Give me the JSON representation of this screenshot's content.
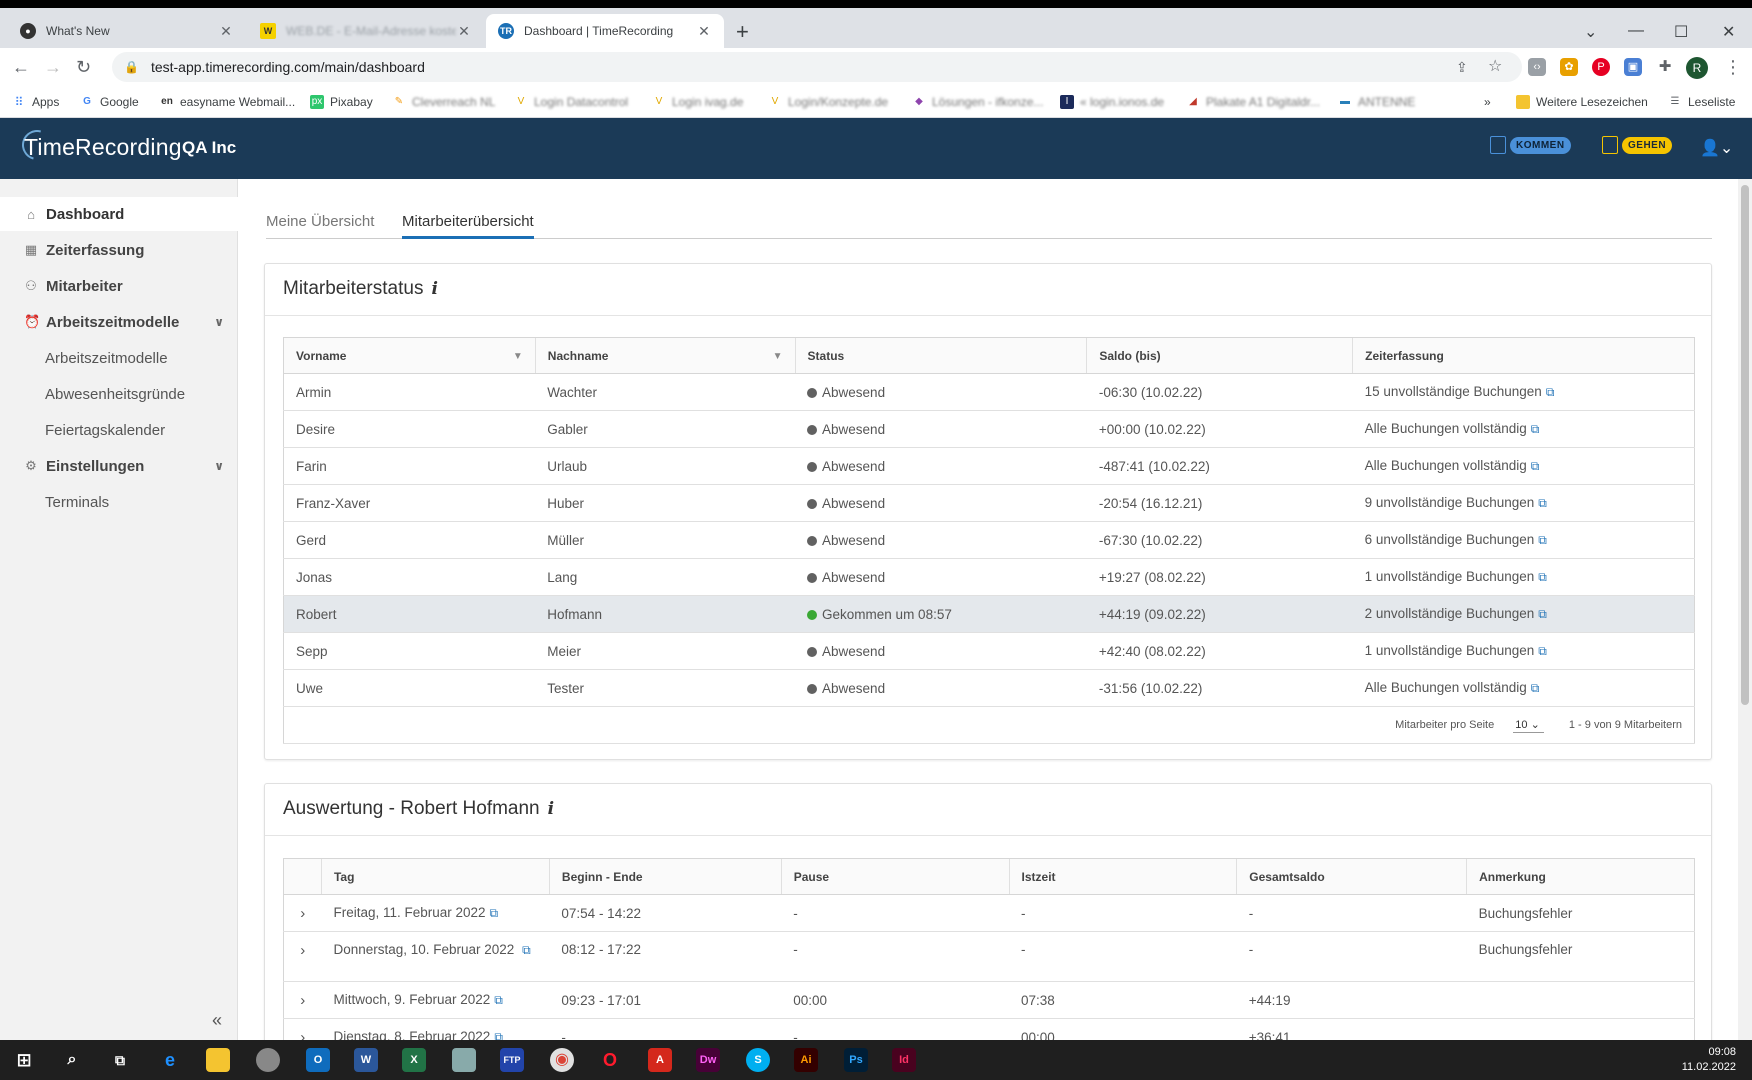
{
  "browser": {
    "tabs": [
      {
        "title": "What's New",
        "icon": "github-icon"
      },
      {
        "title": "WEB.DE - E-Mail-Adresse kosten",
        "icon": "webde-icon"
      },
      {
        "title": "Dashboard | TimeRecording",
        "icon": "timerecording-icon"
      }
    ],
    "url": "test-app.timerecording.com/main/dashboard",
    "profile_initial": "R",
    "bookmarks": [
      {
        "label": "Apps"
      },
      {
        "label": "Google"
      },
      {
        "label": "easyname Webmail..."
      },
      {
        "label": "Pixabay"
      },
      {
        "label": "Cleverreach NL"
      },
      {
        "label": "Login Datacontrol"
      },
      {
        "label": "Login ivag.de"
      },
      {
        "label": "Login/Konzepte.de"
      },
      {
        "label": "Lösungen - ifkonze..."
      },
      {
        "label": "« login.ionos.de"
      },
      {
        "label": "Plakate A1 Digitaldr..."
      },
      {
        "label": "ANTENNE"
      }
    ],
    "bookmarks_more": "»",
    "other_bookmarks": "Weitere Lesezeichen",
    "reading_list": "Leseliste"
  },
  "header": {
    "logo": "TimeRecording",
    "company": "QA Inc",
    "kommen": "KOMMEN",
    "gehen": "GEHEN"
  },
  "sidebar": {
    "items": [
      {
        "label": "Dashboard"
      },
      {
        "label": "Zeiterfassung"
      },
      {
        "label": "Mitarbeiter"
      },
      {
        "label": "Arbeitszeitmodelle"
      },
      {
        "label": "Arbeitszeitmodelle"
      },
      {
        "label": "Abwesenheitsgründe"
      },
      {
        "label": "Feiertagskalender"
      },
      {
        "label": "Einstellungen"
      },
      {
        "label": "Terminals"
      }
    ]
  },
  "main": {
    "tabs": [
      {
        "label": "Meine Übersicht"
      },
      {
        "label": "Mitarbeiterübersicht"
      }
    ],
    "status_card": {
      "title": "Mitarbeiterstatus",
      "info": "i",
      "columns": [
        "Vorname",
        "Nachname",
        "Status",
        "Saldo (bis)",
        "Zeiterfassung"
      ],
      "rows": [
        {
          "first": "Armin",
          "last": "Wachter",
          "status": "Abwesend",
          "saldo": "-06:30 (10.02.22)",
          "booking": "15 unvollständige Buchungen"
        },
        {
          "first": "Desire",
          "last": "Gabler",
          "status": "Abwesend",
          "saldo": "+00:00 (10.02.22)",
          "booking": "Alle Buchungen vollständig"
        },
        {
          "first": "Farin",
          "last": "Urlaub",
          "status": "Abwesend",
          "saldo": "-487:41 (10.02.22)",
          "booking": "Alle Buchungen vollständig"
        },
        {
          "first": "Franz-Xaver",
          "last": "Huber",
          "status": "Abwesend",
          "saldo": "-20:54 (16.12.21)",
          "booking": "9 unvollständige Buchungen"
        },
        {
          "first": "Gerd",
          "last": "Müller",
          "status": "Abwesend",
          "saldo": "-67:30 (10.02.22)",
          "booking": "6 unvollständige Buchungen"
        },
        {
          "first": "Jonas",
          "last": "Lang",
          "status": "Abwesend",
          "saldo": "+19:27 (08.02.22)",
          "booking": "1 unvollständige Buchungen"
        },
        {
          "first": "Robert",
          "last": "Hofmann",
          "status": "Gekommen um 08:57",
          "saldo": "+44:19 (09.02.22)",
          "booking": "2 unvollständige Buchungen"
        },
        {
          "first": "Sepp",
          "last": "Meier",
          "status": "Abwesend",
          "saldo": "+42:40 (08.02.22)",
          "booking": "1 unvollständige Buchungen"
        },
        {
          "first": "Uwe",
          "last": "Tester",
          "status": "Abwesend",
          "saldo": "-31:56 (10.02.22)",
          "booking": "Alle Buchungen vollständig"
        }
      ],
      "pagination": {
        "per_page_label": "Mitarbeiter pro Seite",
        "per_page_value": "10",
        "range": "1 - 9 von 9 Mitarbeitern"
      }
    },
    "eval_card": {
      "title": "Auswertung - Robert Hofmann",
      "info": "i",
      "columns": [
        "Tag",
        "Beginn - Ende",
        "Pause",
        "Istzeit",
        "Gesamtsaldo",
        "Anmerkung"
      ],
      "rows": [
        {
          "tag": "Freitag, 11. Februar 2022",
          "time": "07:54 - 14:22",
          "pause": "-",
          "ist": "-",
          "saldo": "-",
          "note": "Buchungsfehler"
        },
        {
          "tag": "Donnerstag, 10. Februar 2022",
          "time": "08:12 - 17:22",
          "pause": "-",
          "ist": "-",
          "saldo": "-",
          "note": "Buchungsfehler"
        },
        {
          "tag": "Mittwoch, 9. Februar 2022",
          "time": "09:23 - 17:01",
          "pause": "00:00",
          "ist": "07:38",
          "saldo": "+44:19",
          "note": ""
        },
        {
          "tag": "Dienstag, 8. Februar 2022",
          "time": "-",
          "pause": "-",
          "ist": "00:00",
          "saldo": "+36:41",
          "note": ""
        }
      ]
    }
  },
  "taskbar": {
    "time": "09:08",
    "date": "11.02.2022"
  },
  "colors": {
    "header_bg": "#1b3a57",
    "accent_blue": "#1b6fb5",
    "kommen": "#4a90d9",
    "gehen": "#f5c400",
    "status_present": "#3aa835",
    "status_absent": "#616161"
  }
}
